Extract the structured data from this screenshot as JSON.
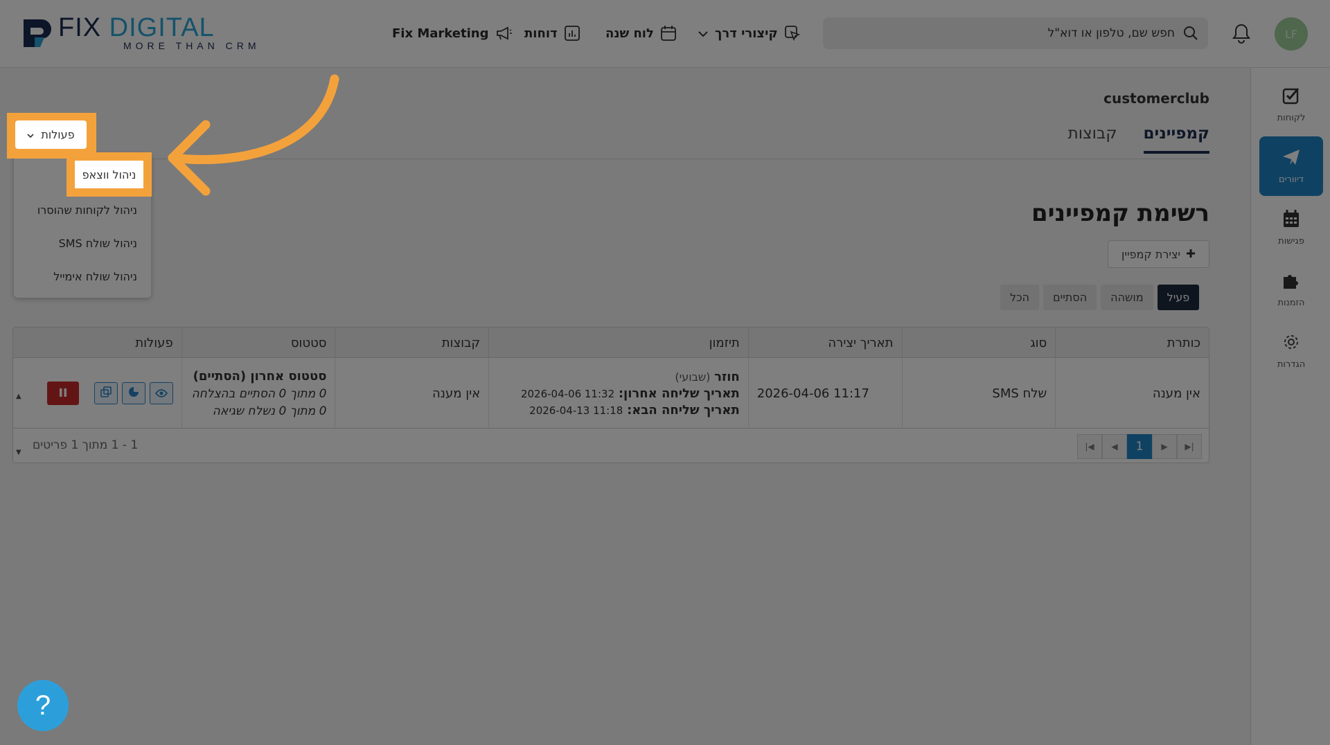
{
  "header": {
    "logo_title_a": "FIX",
    "logo_title_b": " DIGITAL",
    "logo_sub": "MORE THAN CRM",
    "nav": {
      "marketing": "Fix Marketing",
      "reports": "דוחות",
      "calendar": "לוח שנה",
      "shortcuts": "קיצורי דרך"
    },
    "search_placeholder": "חפש שם, טלפון או דוא\"ל",
    "avatar_initials": "LF"
  },
  "sidebar": {
    "items": [
      {
        "label": "לקוחות",
        "icon": "checkbox-icon"
      },
      {
        "label": "דיוורים",
        "icon": "paper-plane-icon"
      },
      {
        "label": "פגישות",
        "icon": "calendar-icon"
      },
      {
        "label": "הזמנות",
        "icon": "puzzle-icon"
      },
      {
        "label": "הגדרות",
        "icon": "gear-icon"
      }
    ]
  },
  "main": {
    "breadcrumb": "customerclub",
    "tabs": [
      "קמפיינים",
      "קבוצות"
    ],
    "page_title": "רשימת קמפיינים",
    "create_button": "יצירת קמפיין",
    "filters": [
      "פעיל",
      "מושהה",
      "הסתיים",
      "הכל"
    ],
    "table": {
      "headers": [
        "כותרת",
        "סוג",
        "תאריך יצירה",
        "תיזמון",
        "קבוצות",
        "סטטוס",
        "פעולות"
      ],
      "rows": [
        {
          "title": "אין מענה",
          "type": "שלח SMS",
          "created": "2026-04-06 11:17",
          "schedule_kind": "חוזר",
          "schedule_freq": "(שבועי)",
          "last_send_label": "תאריך שליחה אחרון:",
          "last_send_value": "2026-04-06 11:32",
          "next_send_label": "תאריך שליחה הבא:",
          "next_send_value": "2026-04-13 11:18",
          "groups": "אין מענה",
          "status_title": "סטטוס אחרון (הסתיים)",
          "status_line1": "0 מתוך 0 הסתיים בהצלחה",
          "status_line2": "0 מתוך 0 נשלח שגיאה"
        }
      ]
    },
    "pagination": {
      "current": "1"
    },
    "items_count": "1 - 1 מתוך 1 פריטים"
  },
  "actions_menu": {
    "button_label": "פעולות",
    "items": [
      "ניהול ווצאפ",
      "ניהול לקוחות שהוסרו",
      "ניהול שולח SMS",
      "ניהול שולח אימייל"
    ]
  },
  "colors": {
    "brand_dark": "#1b2a52",
    "brand_accent": "#2ba5d6",
    "active_blue": "#1e84c4",
    "highlight_orange": "#f3a23b",
    "pause_red": "#c62b2b"
  },
  "help_label": "?"
}
